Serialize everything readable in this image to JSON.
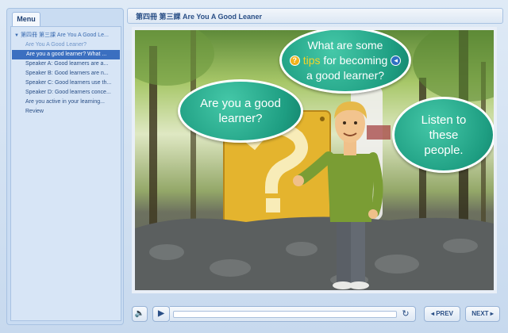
{
  "sidebar": {
    "tab_label": "Menu",
    "items": [
      {
        "label": "第四冊 第三課 Are You A Good Le...",
        "level": "root",
        "selected": false
      },
      {
        "label": "Are You A Good Leaner?",
        "level": "sub",
        "selected": false
      },
      {
        "label": "Are you a good learner? What ...",
        "level": "item",
        "selected": true
      },
      {
        "label": "Speaker A: Good learners are a...",
        "level": "item",
        "selected": false
      },
      {
        "label": "Speaker B: Good learners are n...",
        "level": "item",
        "selected": false
      },
      {
        "label": "Speaker C: Good learners use th...",
        "level": "item",
        "selected": false
      },
      {
        "label": "Speaker D: Good learners conce...",
        "level": "item",
        "selected": false
      },
      {
        "label": "Are you active in your learning...",
        "level": "item",
        "selected": false
      },
      {
        "label": "Review",
        "level": "item",
        "selected": false
      }
    ]
  },
  "header": {
    "title": "第四冊 第三課 Are You A Good Leaner"
  },
  "slide": {
    "bubble_left": {
      "line1": "Are you a good",
      "line2": "learner?"
    },
    "bubble_top": {
      "line1": "What are some",
      "line2_tips": "tips",
      "line2_rest": " for becoming",
      "line3": "a good learner?",
      "q_icon": "?",
      "arrow_icon": "➜"
    },
    "bubble_right": {
      "line1": "Listen to",
      "line2": "these",
      "line3": "people."
    }
  },
  "controls": {
    "volume_icon": "🔈",
    "play_icon": "▶",
    "replay_icon": "↻",
    "progress": 0.0,
    "prev_label": "◂ PREV",
    "next_label": "NEXT ▸"
  },
  "colors": {
    "accent": "#3b6fc0",
    "bubble": "#1e9e82",
    "tips_highlight": "#f6d327"
  }
}
